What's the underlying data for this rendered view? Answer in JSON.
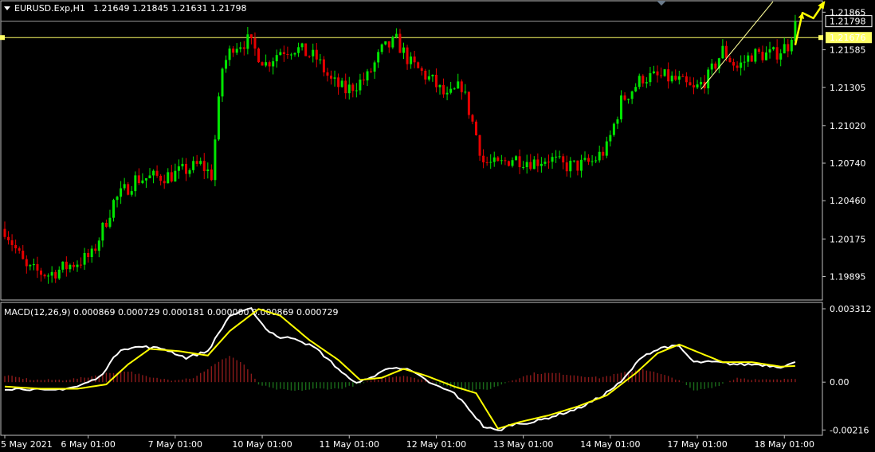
{
  "colors": {
    "background": "#000000",
    "bull": "#00e600",
    "bear": "#e60000",
    "grid_border": "#c0c0c0",
    "price_line": "#ffff66",
    "support_line": "#ffff99",
    "macd_main": "#ffffff",
    "macd_signal": "#ffff00",
    "hist_positive": "#8b1a1a",
    "hist_negative": "#1a6b1a",
    "arrow": "#ffff00"
  },
  "chart_data": [
    {
      "type": "candlestick",
      "title": "EURUSD.Exp,H1",
      "ohlc_header": [
        "1.21649",
        "1.21845",
        "1.21631",
        "1.21798"
      ],
      "ylim": [
        1.1972,
        1.2195
      ],
      "y_ticks": [
        "1.21865",
        "1.21585",
        "1.21305",
        "1.21020",
        "1.20740",
        "1.20460",
        "1.20175",
        "1.19895"
      ],
      "y_tick_values": [
        1.21865,
        1.21585,
        1.21305,
        1.2102,
        1.2074,
        1.2046,
        1.20175,
        1.19895
      ],
      "price_labels": [
        {
          "text": "1.21798",
          "value": 1.21798,
          "style": "bid"
        },
        {
          "text": "1.21676",
          "value": 1.21676,
          "style": "highlight"
        }
      ],
      "horizontal_level": 1.21676,
      "x_labels": [
        "5 May 2021",
        "6 May 01:00",
        "7 May 01:00",
        "10 May 01:00",
        "11 May 01:00",
        "12 May 01:00",
        "13 May 01:00",
        "14 May 01:00",
        "17 May 01:00",
        "18 May 01:00"
      ],
      "x_label_bar_index": [
        0,
        23,
        47,
        71,
        95,
        119,
        143,
        167,
        191,
        215
      ],
      "path_anchors": [
        [
          0,
          1.2025
        ],
        [
          6,
          1.1995
        ],
        [
          12,
          1.1991
        ],
        [
          24,
          1.2005
        ],
        [
          30,
          1.2045
        ],
        [
          36,
          1.2062
        ],
        [
          46,
          1.2065
        ],
        [
          54,
          1.2073
        ],
        [
          57,
          1.2065
        ],
        [
          60,
          1.2145
        ],
        [
          63,
          1.2162
        ],
        [
          67,
          1.2165
        ],
        [
          72,
          1.2148
        ],
        [
          76,
          1.2158
        ],
        [
          80,
          1.216
        ],
        [
          86,
          1.2152
        ],
        [
          90,
          1.2135
        ],
        [
          94,
          1.2128
        ],
        [
          100,
          1.2138
        ],
        [
          104,
          1.2158
        ],
        [
          108,
          1.2165
        ],
        [
          112,
          1.2148
        ],
        [
          118,
          1.2135
        ],
        [
          122,
          1.2122
        ],
        [
          126,
          1.2132
        ],
        [
          130,
          1.2095
        ],
        [
          132,
          1.2075
        ],
        [
          136,
          1.2072
        ],
        [
          140,
          1.2078
        ],
        [
          146,
          1.2075
        ],
        [
          150,
          1.2078
        ],
        [
          154,
          1.2072
        ],
        [
          158,
          1.2072
        ],
        [
          162,
          1.2075
        ],
        [
          166,
          1.2085
        ],
        [
          170,
          1.212
        ],
        [
          176,
          1.2138
        ],
        [
          182,
          1.2138
        ],
        [
          186,
          1.2135
        ],
        [
          190,
          1.2128
        ],
        [
          194,
          1.2138
        ],
        [
          198,
          1.2158
        ],
        [
          202,
          1.2145
        ],
        [
          206,
          1.2155
        ],
        [
          212,
          1.2155
        ],
        [
          216,
          1.2162
        ],
        [
          218,
          1.21798
        ]
      ],
      "support_line": [
        [
          192,
          1.2129
        ],
        [
          240,
          1.2205
        ]
      ],
      "forecast_arrow": [
        [
          218,
          1.2162
        ],
        [
          220,
          1.2186
        ],
        [
          223,
          1.2182
        ],
        [
          226,
          1.2194
        ]
      ]
    },
    {
      "type": "line",
      "title": "MACD(12,26,9) 0.000869 0.000729 0.000181 0.000000 0.000869 0.000729",
      "ylim": [
        -0.0024,
        0.0036
      ],
      "y_ticks": [
        "0.003312",
        "0.00",
        "-0.00216"
      ],
      "y_tick_values": [
        0.003312,
        0.0,
        -0.00216
      ],
      "series": [
        {
          "name": "",
          "role": "main",
          "points": [
            [
              0,
              -0.0003
            ],
            [
              6,
              -0.0003
            ],
            [
              12,
              -0.0004
            ],
            [
              20,
              -0.0002
            ],
            [
              26,
              0.0002
            ],
            [
              32,
              0.0015
            ],
            [
              38,
              0.0016
            ],
            [
              44,
              0.0015
            ],
            [
              50,
              0.0011
            ],
            [
              56,
              0.0014
            ],
            [
              62,
              0.003
            ],
            [
              68,
              0.0033
            ],
            [
              72,
              0.0024
            ],
            [
              76,
              0.002
            ],
            [
              80,
              0.002
            ],
            [
              86,
              0.0015
            ],
            [
              92,
              0.0006
            ],
            [
              96,
              0.0
            ],
            [
              100,
              0.0001
            ],
            [
              104,
              0.0005
            ],
            [
              108,
              0.0007
            ],
            [
              112,
              0.0005
            ],
            [
              118,
              -0.0001
            ],
            [
              124,
              -0.0005
            ],
            [
              128,
              -0.0012
            ],
            [
              132,
              -0.002
            ],
            [
              136,
              -0.0022
            ],
            [
              140,
              -0.0019
            ],
            [
              146,
              -0.0018
            ],
            [
              152,
              -0.0015
            ],
            [
              158,
              -0.0012
            ],
            [
              164,
              -0.0007
            ],
            [
              170,
              0.0
            ],
            [
              176,
              0.0012
            ],
            [
              182,
              0.0016
            ],
            [
              186,
              0.0016
            ],
            [
              190,
              0.0009
            ],
            [
              196,
              0.0009
            ],
            [
              202,
              0.0008
            ],
            [
              208,
              0.0008
            ],
            [
              214,
              0.0007
            ],
            [
              218,
              0.00087
            ]
          ]
        },
        {
          "name": "",
          "role": "signal",
          "points": [
            [
              0,
              -0.0002
            ],
            [
              10,
              -0.0003
            ],
            [
              20,
              -0.0003
            ],
            [
              28,
              -0.0001
            ],
            [
              34,
              0.0008
            ],
            [
              40,
              0.0015
            ],
            [
              48,
              0.0014
            ],
            [
              56,
              0.0012
            ],
            [
              62,
              0.0023
            ],
            [
              70,
              0.0033
            ],
            [
              76,
              0.003
            ],
            [
              84,
              0.0019
            ],
            [
              92,
              0.001
            ],
            [
              98,
              0.0001
            ],
            [
              104,
              0.0002
            ],
            [
              110,
              0.0006
            ],
            [
              116,
              0.0003
            ],
            [
              124,
              -0.0002
            ],
            [
              130,
              -0.0005
            ],
            [
              136,
              -0.0021
            ],
            [
              142,
              -0.0018
            ],
            [
              150,
              -0.0015
            ],
            [
              158,
              -0.0011
            ],
            [
              166,
              -0.0006
            ],
            [
              174,
              0.0004
            ],
            [
              180,
              0.0013
            ],
            [
              186,
              0.0017
            ],
            [
              192,
              0.0013
            ],
            [
              198,
              0.0009
            ],
            [
              206,
              0.0009
            ],
            [
              214,
              0.0007
            ],
            [
              218,
              0.00073
            ]
          ]
        }
      ],
      "histogram": [
        [
          0,
          0.0003
        ],
        [
          8,
          0.0001
        ],
        [
          16,
          0.0001
        ],
        [
          22,
          0.0002
        ],
        [
          28,
          0.0004
        ],
        [
          34,
          0.0005
        ],
        [
          40,
          0.0002
        ],
        [
          46,
          0.0001
        ],
        [
          52,
          0.0002
        ],
        [
          58,
          0.0008
        ],
        [
          62,
          0.0012
        ],
        [
          66,
          0.0008
        ],
        [
          70,
          -0.0001
        ],
        [
          74,
          -0.0003
        ],
        [
          80,
          -0.0004
        ],
        [
          86,
          -0.0003
        ],
        [
          92,
          -0.0003
        ],
        [
          98,
          -0.0001
        ],
        [
          104,
          0.0002
        ],
        [
          110,
          0.0003
        ],
        [
          116,
          0.0001
        ],
        [
          122,
          -0.0002
        ],
        [
          128,
          -0.0004
        ],
        [
          134,
          -0.0003
        ],
        [
          140,
          0.0001
        ],
        [
          146,
          0.0004
        ],
        [
          152,
          0.0004
        ],
        [
          158,
          0.0003
        ],
        [
          164,
          0.0002
        ],
        [
          170,
          0.0004
        ],
        [
          176,
          0.0006
        ],
        [
          180,
          0.0004
        ],
        [
          186,
          0.0001
        ],
        [
          190,
          -0.0004
        ],
        [
          196,
          -0.0002
        ],
        [
          202,
          0.0002
        ],
        [
          208,
          0.0001
        ],
        [
          214,
          0.0001
        ],
        [
          218,
          0.00018
        ]
      ]
    }
  ]
}
